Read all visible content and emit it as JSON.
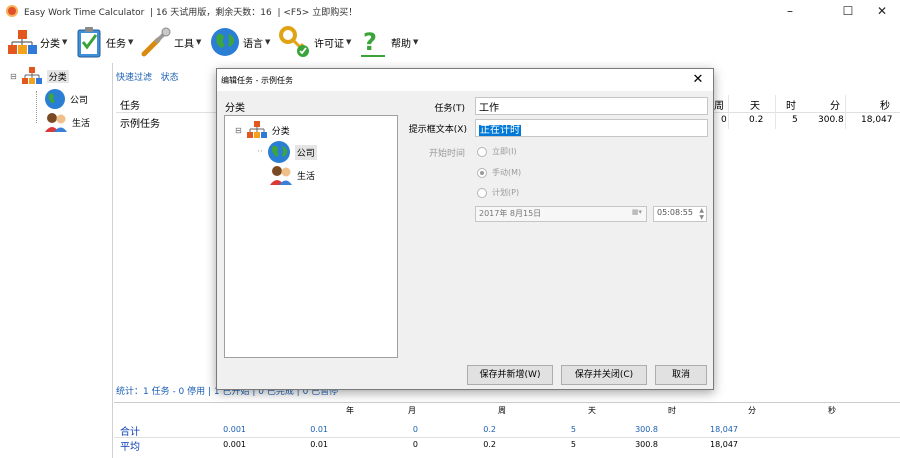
{
  "window": {
    "title": "Easy Work Time Calculator",
    "trial_text": "16 天试用版，剩余天数：16",
    "buy_text": "<F5> 立即购买！",
    "controls": {
      "minimize": "–",
      "maximize": "☐",
      "close": "✕"
    }
  },
  "toolbar": {
    "items": [
      {
        "label": "分类",
        "icon": "category-icon"
      },
      {
        "label": "任务",
        "icon": "task-clipboard-icon"
      },
      {
        "label": "工具",
        "icon": "tools-icon"
      },
      {
        "label": "语言",
        "icon": "globe-icon"
      },
      {
        "label": "许可证",
        "icon": "key-icon"
      },
      {
        "label": "帮助",
        "icon": "help-icon"
      }
    ]
  },
  "left_tree": {
    "root": "分类",
    "children": [
      "公司",
      "生活"
    ]
  },
  "filter_bar": {
    "quick_filter": "快速过滤",
    "status": "状态"
  },
  "grid": {
    "columns": [
      "任务",
      "周",
      "天",
      "时",
      "分",
      "秒"
    ],
    "rows": [
      {
        "task": "示例任务",
        "week": "0",
        "day": "0.2",
        "hour": "5",
        "minute": "300.8",
        "second": "18,047"
      }
    ]
  },
  "status_line": "统计：1 任务 - 0 停用 | 1 已开始 | 0 已完成 | 0 已暂停",
  "summary": {
    "columns": [
      "年",
      "月",
      "周",
      "天",
      "时",
      "分",
      "秒"
    ],
    "rows": [
      {
        "label": "合计",
        "values": [
          "0.001",
          "0.01",
          "0",
          "0.2",
          "5",
          "300.8",
          "18,047"
        ],
        "color": "#1a5fb4"
      },
      {
        "label": "平均",
        "values": [
          "0.001",
          "0.01",
          "0",
          "0.2",
          "5",
          "300.8",
          "18,047"
        ],
        "color": "#000000"
      }
    ]
  },
  "dialog": {
    "title": "编辑任务 - 示例任务",
    "category_label": "分类",
    "tree": {
      "root": "分类",
      "children": [
        "公司",
        "生活"
      ],
      "selected": "公司"
    },
    "task_label": "任务(T)",
    "task_value": "工作",
    "reminder_label": "提示框文本(X)",
    "reminder_value": "正在计时",
    "start_time_label": "开始时间",
    "radio_options": [
      {
        "label": "立即(I)",
        "checked": false
      },
      {
        "label": "手动(M)",
        "checked": true
      },
      {
        "label": "计划(P)",
        "checked": false
      }
    ],
    "date_value": "2017年  8月15日",
    "time_value": "05:08:55",
    "buttons": {
      "save_new": "保存并新增(W)",
      "save_close": "保存并关闭(C)",
      "cancel": "取消"
    }
  },
  "colors": {
    "accent": "#1a5fb4",
    "sum_label": "#0b3fb7",
    "selection": "#0078d7"
  }
}
